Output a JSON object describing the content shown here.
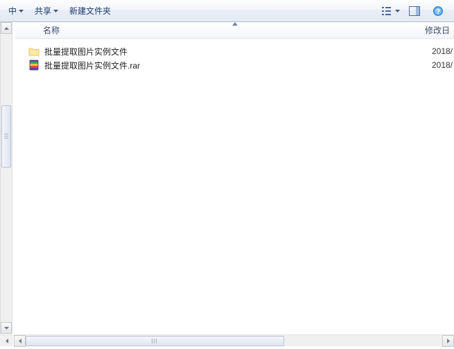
{
  "toolbar": {
    "include_label": "中",
    "share_label": "共享",
    "newfolder_label": "新建文件夹"
  },
  "columns": {
    "name": "名称",
    "modified": "修改日"
  },
  "files": [
    {
      "type": "folder",
      "name": "批量提取图片实例文件",
      "date": "2018/"
    },
    {
      "type": "rar",
      "name": "批量提取图片实例文件.rar",
      "date": "2018/"
    }
  ]
}
